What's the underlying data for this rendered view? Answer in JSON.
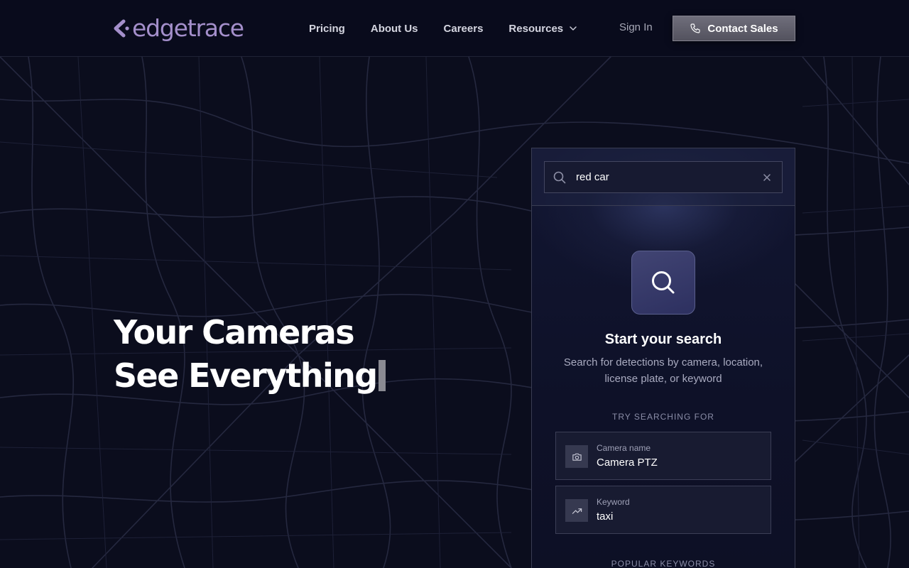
{
  "brand": {
    "name": "edgetrace",
    "color": "#a48fcb"
  },
  "nav": {
    "links": [
      "Pricing",
      "About Us",
      "Careers"
    ],
    "resources_label": "Resources",
    "sign_in": "Sign In",
    "contact": "Contact Sales"
  },
  "hero": {
    "line1": "Your Cameras",
    "line2": "See Everything"
  },
  "search_panel": {
    "query": "red car",
    "title": "Start your search",
    "description": "Search for detections by camera, location, license plate, or keyword",
    "try_label": "TRY SEARCHING FOR",
    "suggestions": [
      {
        "label": "Camera name",
        "value": "Camera PTZ",
        "icon": "camera-icon"
      },
      {
        "label": "Keyword",
        "value": "taxi",
        "icon": "trending-icon"
      }
    ],
    "popular_label": "POPULAR KEYWORDS"
  },
  "colors": {
    "background": "#0b0d1d",
    "panel": "#121632",
    "accent_icon_bg": "#3a3d6b"
  }
}
